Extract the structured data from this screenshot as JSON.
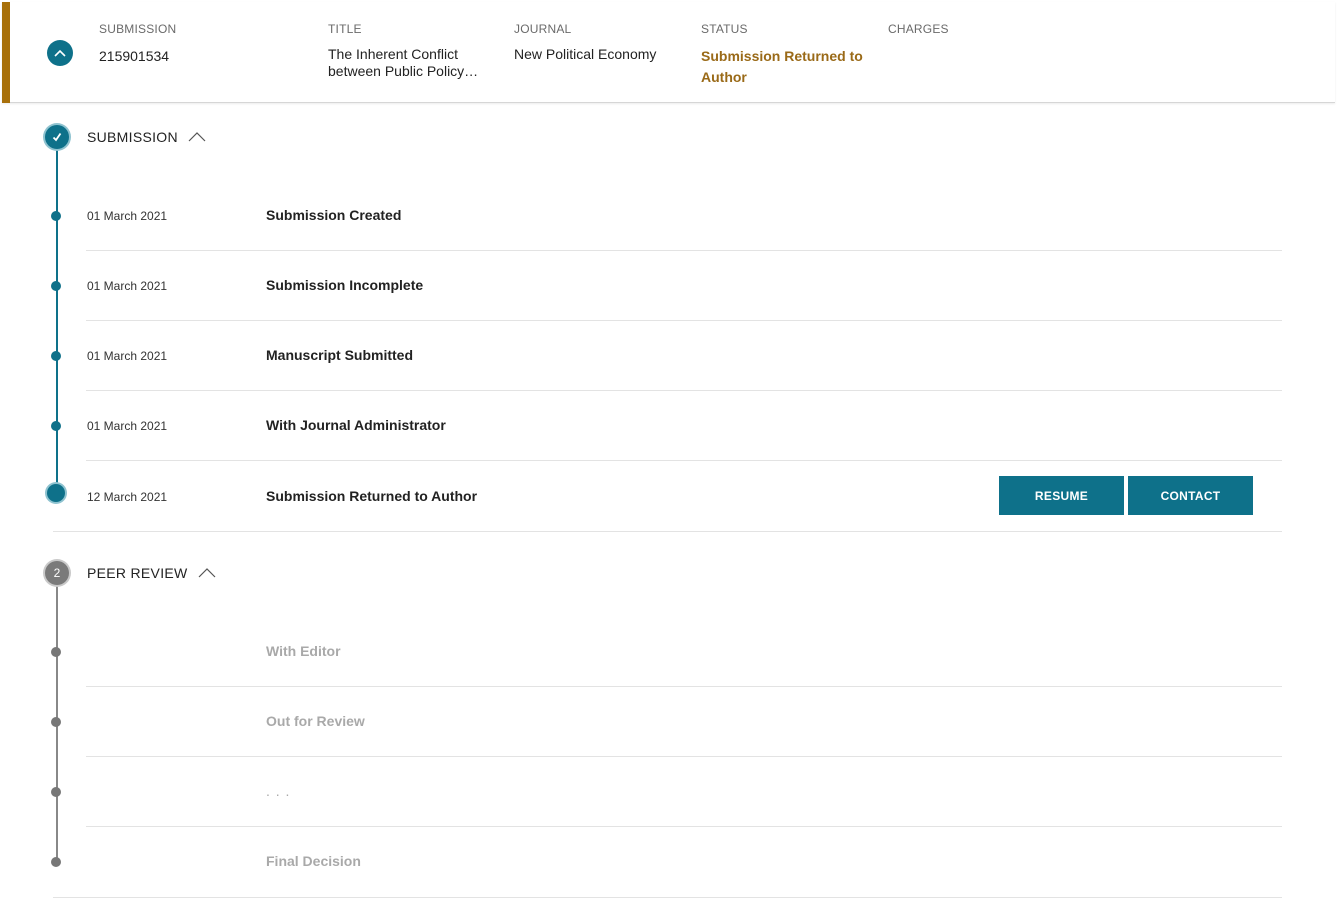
{
  "header": {
    "columns": {
      "submission": {
        "label": "SUBMISSION",
        "value": "215901534"
      },
      "title": {
        "label": "TITLE",
        "value": "The Inherent Conflict between Public Policy…"
      },
      "journal": {
        "label": "JOURNAL",
        "value": "New Political Economy"
      },
      "status": {
        "label": "STATUS",
        "value": "Submission Returned to Author"
      },
      "charges": {
        "label": "CHARGES",
        "value": ""
      }
    },
    "accent_color": "#a8700a",
    "status_color": "#9a6a18"
  },
  "sections": [
    {
      "number": "1",
      "title": "SUBMISSION",
      "state": "complete",
      "events": [
        {
          "date": "01 March 2021",
          "label": "Submission Created"
        },
        {
          "date": "01 March 2021",
          "label": "Submission Incomplete"
        },
        {
          "date": "01 March 2021",
          "label": "Manuscript Submitted"
        },
        {
          "date": "01 March 2021",
          "label": "With Journal Administrator"
        },
        {
          "date": "12 March 2021",
          "label": "Submission Returned to Author"
        }
      ],
      "actions": {
        "resume_label": "RESUME",
        "contact_label": "CONTACT"
      }
    },
    {
      "number": "2",
      "title": "PEER REVIEW",
      "state": "pending",
      "events": [
        {
          "date": "",
          "label": "With Editor"
        },
        {
          "date": "",
          "label": "Out for Review"
        },
        {
          "date": "",
          "label": ". . ."
        },
        {
          "date": "",
          "label": "Final Decision"
        }
      ]
    }
  ],
  "colors": {
    "primary": "#0e718a",
    "muted_text": "#a9a9a9",
    "pending": "#7a7a7a"
  },
  "icons": {
    "toggle": "chevron-up-icon",
    "section_done": "check-icon",
    "caret": "chevron-up-icon"
  }
}
